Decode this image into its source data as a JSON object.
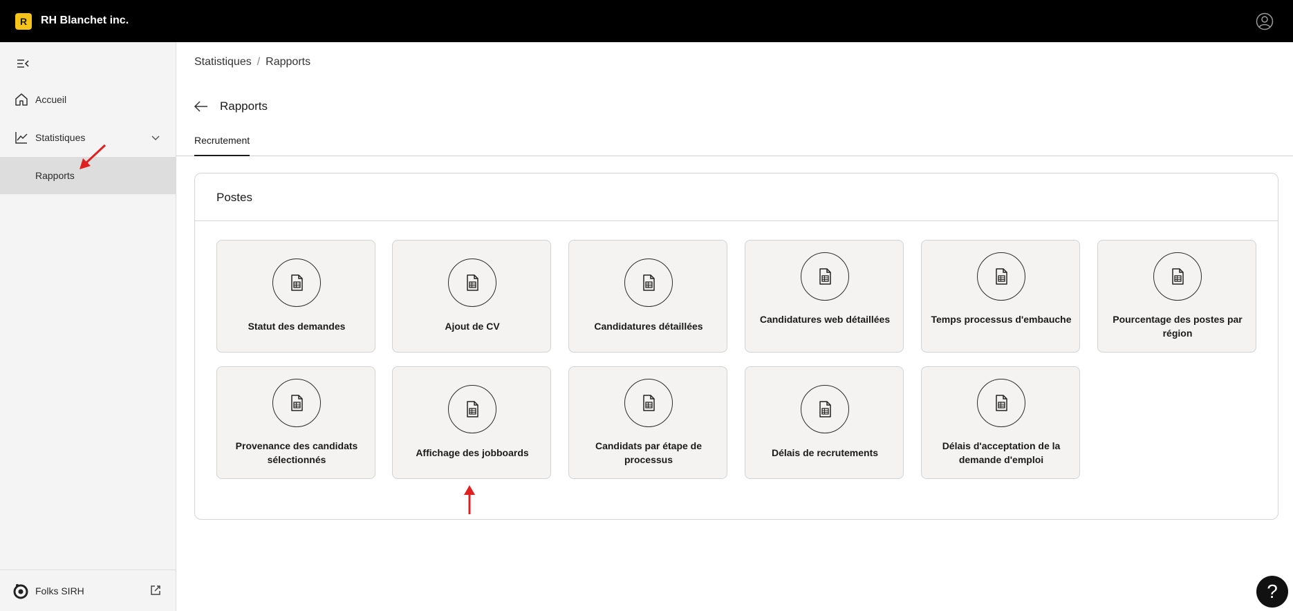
{
  "header": {
    "logo_letter": "R",
    "company": "RH Blanchet inc.",
    "accent": "#f6c318"
  },
  "sidebar": {
    "items": [
      {
        "label": "Accueil",
        "icon": "home-icon"
      },
      {
        "label": "Statistiques",
        "icon": "chart-icon"
      },
      {
        "label": "Rapports"
      }
    ],
    "footer_label": "Folks SIRH"
  },
  "breadcrumb": {
    "parent": "Statistiques",
    "separator": "/",
    "current": "Rapports"
  },
  "page": {
    "title": "Rapports",
    "tab": "Recrutement"
  },
  "panel": {
    "title": "Postes",
    "cards": [
      "Statut des demandes",
      "Ajout de CV",
      "Candidatures détaillées",
      "Candidatures web détaillées",
      "Temps processus d'embauche",
      "Pourcentage des postes par région",
      "Provenance des candidats sélectionnés",
      "Affichage des jobboards",
      "Candidats par étape de processus",
      "Délais de recrutements",
      "Délais d'acceptation de la demande d'emploi"
    ]
  },
  "help": {
    "label": "?"
  },
  "annotation_color": "#e02020"
}
